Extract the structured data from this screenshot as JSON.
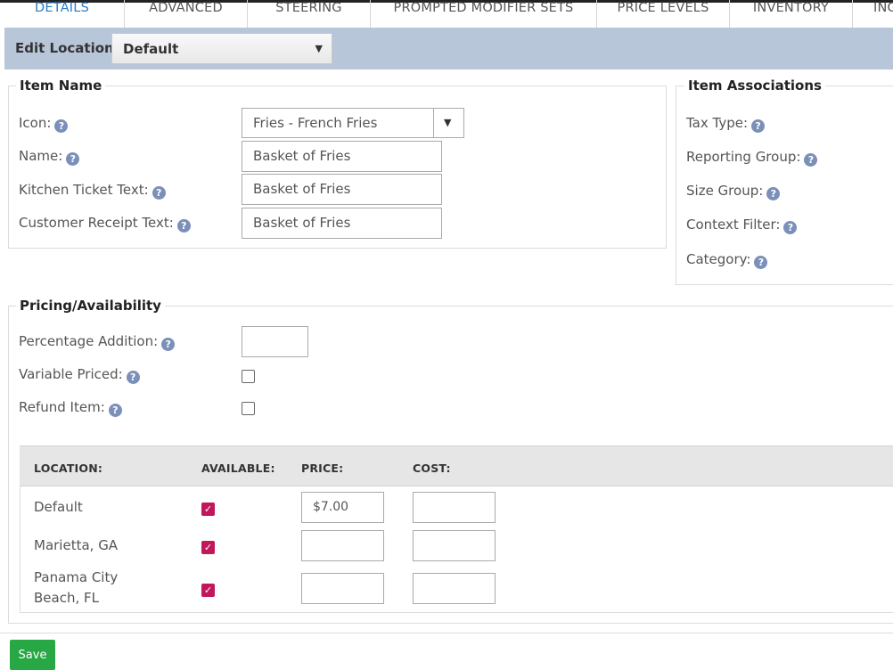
{
  "tabs": [
    {
      "label": "DETAILS"
    },
    {
      "label": "ADVANCED"
    },
    {
      "label": "STEERING"
    },
    {
      "label": "PROMPTED MODIFIER SETS"
    },
    {
      "label": "PRICE LEVELS"
    },
    {
      "label": "INVENTORY"
    },
    {
      "label": "INGREDIENTS"
    }
  ],
  "location_bar": {
    "label": "Edit Location:",
    "selected": "Default"
  },
  "item_name": {
    "legend": "Item Name",
    "icon_label": "Icon:",
    "icon_value": "Fries - French Fries",
    "name_label": "Name:",
    "name_value": "Basket of Fries",
    "kitchen_label": "Kitchen Ticket Text:",
    "kitchen_value": "Basket of Fries",
    "receipt_label": "Customer Receipt Text:",
    "receipt_value": "Basket of Fries"
  },
  "item_associations": {
    "legend": "Item Associations",
    "tax_type": "Tax Type:",
    "reporting_group": "Reporting Group:",
    "size_group": "Size Group:",
    "context_filter": "Context Filter:",
    "category": "Category:"
  },
  "pricing": {
    "legend": "Pricing/Availability",
    "percentage_label": "Percentage Addition:",
    "percentage_value": "",
    "variable_label": "Variable Priced:",
    "variable_checked": false,
    "refund_label": "Refund Item:",
    "refund_checked": false
  },
  "table": {
    "headers": {
      "location": "LOCATION:",
      "available": "AVAILABLE:",
      "price": "PRICE:",
      "cost": "COST:"
    },
    "rows": [
      {
        "location": "Default",
        "available": true,
        "price": "$7.00",
        "cost": ""
      },
      {
        "location": "Marietta, GA",
        "available": true,
        "price": "",
        "cost": ""
      },
      {
        "location": "Panama City Beach, FL",
        "available": true,
        "price": "",
        "cost": ""
      }
    ]
  },
  "save_label": "Save",
  "help_glyph": "?",
  "check_glyph": "✓",
  "dropdown_arrow": "▼",
  "colors": {
    "active_tab": "#2c7bc7",
    "location_bar": "#b8c6d9",
    "checkbox_checked": "#c2185b",
    "save_button": "#28a745",
    "help_icon": "#7b90b8"
  }
}
